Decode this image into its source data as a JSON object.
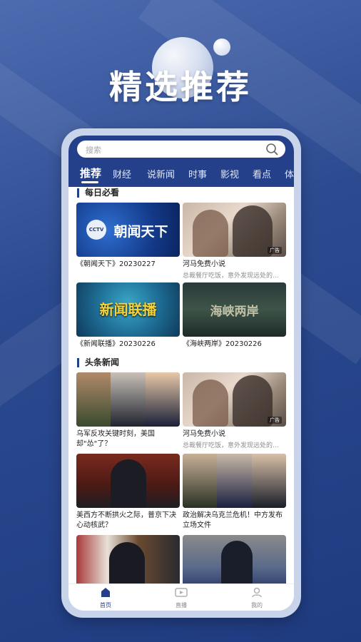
{
  "promo": {
    "title": "精选推荐"
  },
  "search": {
    "placeholder": "搜索"
  },
  "tabs": [
    "推荐",
    "财经",
    "说新闻",
    "时事",
    "影视",
    "看点",
    "体"
  ],
  "sections": {
    "daily": {
      "title": "每日必看",
      "cards": [
        {
          "caption": "《朝闻天下》20230227",
          "thumb_text": "朝闻天下",
          "logo": "CCTV"
        },
        {
          "caption": "河马免费小说",
          "subtitle": "总裁餐厅吃饭，意外发现远处的...",
          "badge": "广告"
        },
        {
          "caption": "《新闻联播》20230226",
          "thumb_text": "新闻联播"
        },
        {
          "caption": "《海峡两岸》20230226",
          "thumb_text": "海峡两岸"
        }
      ]
    },
    "headlines": {
      "title": "头条新闻",
      "cards": [
        {
          "caption": "乌军反攻关键时刻，美国却\"怂\"了？"
        },
        {
          "caption": "河马免费小说",
          "subtitle": "总裁餐厅吃饭，意外发现远处的...",
          "badge": "广告"
        },
        {
          "caption": "美西方不断拱火之际，普京下决心动核武？"
        },
        {
          "caption": "政治解决乌克兰危机！中方发布立场文件"
        }
      ]
    }
  },
  "tabbar": [
    {
      "label": "首页",
      "icon": "home-icon",
      "active": true
    },
    {
      "label": "直播",
      "icon": "live-tv-icon",
      "active": false
    },
    {
      "label": "我的",
      "icon": "profile-icon",
      "active": false
    }
  ],
  "colors": {
    "brand": "#24408a",
    "background": "#2b4a90"
  }
}
